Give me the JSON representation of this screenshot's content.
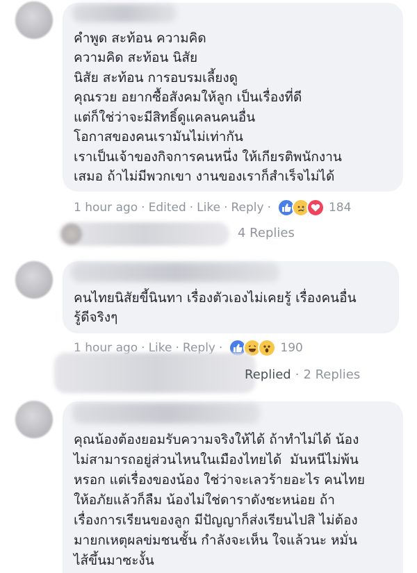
{
  "comments": [
    {
      "lines": [
        "คำพูด สะท้อน ความคิด",
        "ความคิด สะท้อน นิสัย",
        "นิสัย สะท้อน การอบรมเลี้ยงดู",
        "คุณรวย อยากซื้อสังคมให้ลูก เป็นเรื่องที่ดี",
        "แต่ก็ใช่ว่าจะมีสิทธิ์ดูแคลนคนอื่น",
        "โอกาสของคนเรามันไม่เท่ากัน",
        "เราเป็นเจ้าของกิจการคนหนึ่ง ให้เกียรติพนักงาน",
        "เสมอ ถ้าไม่มีพวกเขา งานของเราก็สำเร็จไม่ได้"
      ],
      "time": "1 hour ago",
      "edited": "Edited",
      "like": "Like",
      "reply": "Reply",
      "reaction_icons": [
        "like-icon",
        "sad-icon",
        "love-icon"
      ],
      "reaction_count": "184",
      "replies_label": "4 Replies"
    },
    {
      "lines": [
        "คนไทยนิสัยขี้นินทา เรื่องตัวเองไม่เคยรู้ เรื่องคนอื่น",
        "รู้ดีจริงๆ"
      ],
      "time": "1 hour ago",
      "like": "Like",
      "reply": "Reply",
      "reaction_icons": [
        "like-icon",
        "haha-icon",
        "wow-icon"
      ],
      "reaction_count": "190",
      "replied_label": "Replied",
      "replies_label": "2 Replies"
    },
    {
      "lines": [
        "คุณน้องต้องยอมรับความจริงให้ได้ ถ้าทำไม่ได้ น้อง",
        "ไม่สามารถอยู่ส่วนไหนในเมืองไทยได้  มันหนีไม่พ้น",
        "หรอก แต่เรื่องของน้อง ใช่ว่าจะเลวร้ายอะไร คนไทย",
        "ให้อภัยแล้วก็ลืม น้องไม่ใช่ดาราดังชะหน่อย ถ้า",
        "เรื่องการเรียนของลูก มีปัญญาก็ส่งเรียนไปสิ ไม่ต้อง",
        "มายกเหตุผลข่มชนชั้น กำลังจะเห็น ใจแล้วนะ หมั่น",
        "ไส้ขึ้นมาซะงั้น"
      ]
    }
  ],
  "separator": "·",
  "colors": {
    "like": "#4a7fe6",
    "love": "#f0445d",
    "emoji": "#f7c64a",
    "meta": "#90949c",
    "bubble": "#f1f2f5"
  }
}
